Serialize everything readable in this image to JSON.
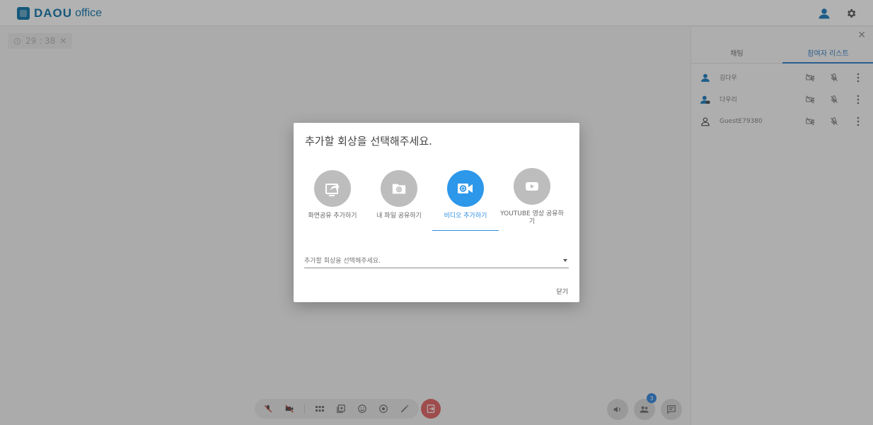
{
  "app": {
    "brand": "DAOU",
    "brand_suffix": "office"
  },
  "header": {
    "icons": [
      "user-icon",
      "gear-icon"
    ]
  },
  "timer": {
    "text": "29 : 38"
  },
  "panel": {
    "tabs": [
      {
        "label": "채팅",
        "active": false
      },
      {
        "label": "참여자 리스트",
        "active": true
      }
    ],
    "participants": [
      {
        "name": "김다우"
      },
      {
        "name": "다우리"
      },
      {
        "name": "GuestE79380"
      }
    ]
  },
  "modal": {
    "title": "추가할 회상을 선택해주세요.",
    "options": [
      {
        "label": "화면공유 추가하기",
        "icon": "screen-share-icon",
        "active": false
      },
      {
        "label": "내 파일 공유하기",
        "icon": "file-share-icon",
        "active": false
      },
      {
        "label": "비디오 추가하기",
        "icon": "video-add-icon",
        "active": true
      },
      {
        "label": "YOUTUBE 영상 공유하기",
        "icon": "youtube-icon",
        "active": false
      }
    ],
    "select_placeholder": "추가할 회상을 선택해주세요.",
    "close_label": "닫기"
  },
  "toolbar": {
    "participant_count": "3"
  },
  "colors": {
    "accent": "#2d97ea",
    "brand": "#1f7fb0",
    "danger": "#e36e6e"
  }
}
